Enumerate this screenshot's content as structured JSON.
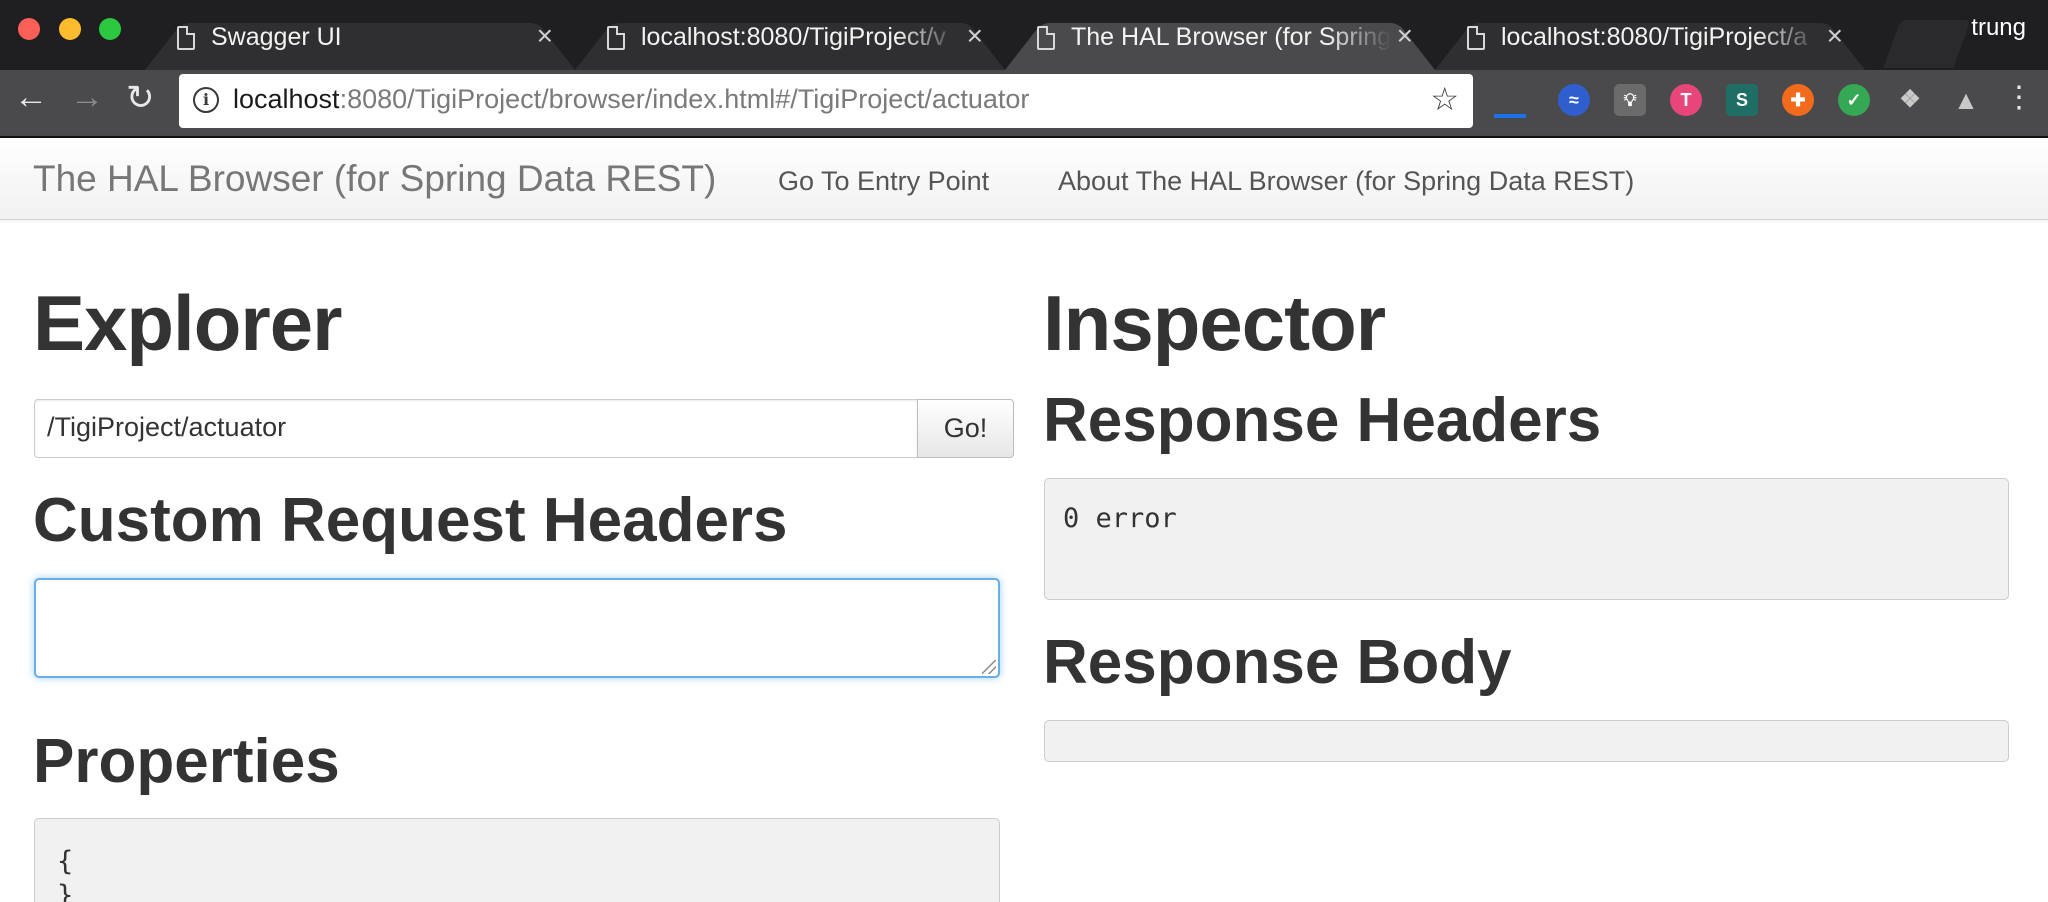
{
  "tabs": [
    {
      "title": "Swagger UI",
      "active": false
    },
    {
      "title": "localhost:8080/TigiProject/v",
      "active": false
    },
    {
      "title": "The HAL Browser (for Spring",
      "active": true
    },
    {
      "title": "localhost:8080/TigiProject/a",
      "active": false
    }
  ],
  "user": {
    "name": "trung"
  },
  "address_bar": {
    "host": "localhost",
    "rest": ":8080/TigiProject/browser/index.html#/TigiProject/actuator"
  },
  "extensions": [
    {
      "name": "loading-indicator",
      "color": "#1a73e8"
    },
    {
      "name": "sync-icon",
      "color": "#4a86e8"
    },
    {
      "name": "lightbulb-icon",
      "color": "#9aa0a6"
    },
    {
      "name": "t-logo-icon",
      "color": "#e8457a"
    },
    {
      "name": "s-logo-icon",
      "color": "#2ba59a"
    },
    {
      "name": "lifebuoy-icon",
      "color": "#f26b1d"
    },
    {
      "name": "shield-check-icon",
      "color": "#34a853"
    },
    {
      "name": "dropbox-icon",
      "color": "#c0c0c0"
    },
    {
      "name": "drive-icon",
      "color": "#c0c0c0"
    }
  ],
  "navbar": {
    "brand": "The HAL Browser (for Spring Data REST)",
    "links": [
      "Go To Entry Point",
      "About The HAL Browser (for Spring Data REST)"
    ]
  },
  "explorer": {
    "heading": "Explorer",
    "url_value": "/TigiProject/actuator",
    "go_label": "Go!",
    "custom_headers_heading": "Custom Request Headers",
    "custom_headers_value": "",
    "properties_heading": "Properties",
    "properties_value": "{\n}"
  },
  "inspector": {
    "heading": "Inspector",
    "response_headers_heading": "Response Headers",
    "response_headers_value": "0 error",
    "response_body_heading": "Response Body",
    "response_body_value": ""
  }
}
